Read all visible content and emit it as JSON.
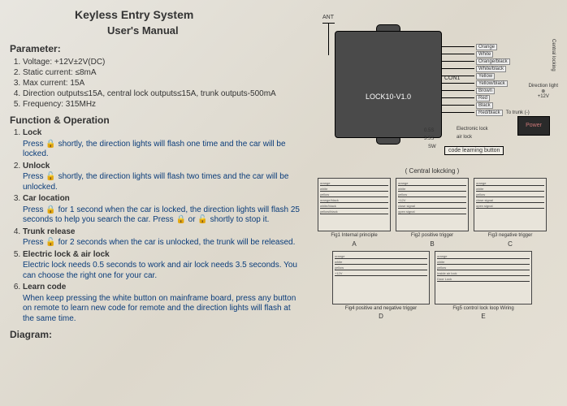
{
  "header": {
    "title": "Keyless Entry System",
    "subtitle": "User's Manual"
  },
  "parameter": {
    "heading": "Parameter:",
    "items": [
      "Voltage: +12V±2V(DC)",
      "Static current: ≤8mA",
      "Max current: 15A",
      "Direction outputs≤15A, central lock outputs≤15A, trunk outputs-500mA",
      "Frequency: 315MHz"
    ]
  },
  "function": {
    "heading": "Function & Operation",
    "items": [
      {
        "title": "Lock",
        "body": "Press 🔒 shortly, the direction lights will flash one time and the car will be locked."
      },
      {
        "title": "Unlock",
        "body": "Press 🔓 shortly, the direction lights will flash two times and the car will be unlocked."
      },
      {
        "title": "Car location",
        "body": "Press 🔒 for 1 second when the car is locked, the direction lights will flash 25 seconds to help you search the car. Press 🔒 or 🔓 shortly to stop it."
      },
      {
        "title": "Trunk release",
        "body": "Press 🔓 for 2 seconds when the car is unlocked, the trunk will be released."
      },
      {
        "title": "Electric lock & air lock",
        "body": "Electric lock needs 0.5 seconds to work and air lock needs 3.5 seconds. You can choose the right one for your car."
      },
      {
        "title": "Learn code",
        "body": "When keep pressing the white button on mainframe board, press any button on remote to learn new code for remote and the direction lights will flash at the same time."
      }
    ]
  },
  "diagram_heading": "Diagram:",
  "main_diagram": {
    "ant": "ANT",
    "chip": "LOCK10-V1.0",
    "con": "CON1",
    "wires": [
      "Orange",
      "White",
      "Orange/black",
      "White/black",
      "Yellow",
      "Yellow/black",
      "Brown",
      "Red",
      "Black",
      "Red/black"
    ],
    "central_locking": "Central locking",
    "direction_light": "Direction light",
    "to_trunk": "To trunk (-)",
    "plus12v": "+12V",
    "power": "Power",
    "elock_time": "0.5S",
    "airlock_time": "3.5S",
    "sw": "SW",
    "elock": "Electronic lock",
    "airlock": "air lock",
    "learn": "code learning button"
  },
  "sub": {
    "group_title": "( Central lokcking )",
    "boxes": [
      {
        "cap": "Fig1 Internal principle",
        "letter": "A",
        "labels": [
          "orange",
          "white",
          "yellow",
          "orange/black",
          "white/black",
          "yellow/black"
        ]
      },
      {
        "cap": "Fig2 positive trigger",
        "letter": "B",
        "labels": [
          "orange",
          "white",
          "yellow",
          "+12V",
          "close signal",
          "open signal"
        ]
      },
      {
        "cap": "Fig3 negative trigger",
        "letter": "C",
        "labels": [
          "orange",
          "white",
          "yellow",
          "close signal",
          "open signal"
        ]
      },
      {
        "cap": "Fig4 positive and negative trigger",
        "letter": "D",
        "labels": [
          "orange",
          "white",
          "yellow",
          "+12V"
        ]
      },
      {
        "cap": "Fig5 control lock loop Wiring",
        "letter": "E",
        "labels": [
          "orange",
          "white",
          "yellow",
          "Inside air lock",
          "Door Lock"
        ]
      }
    ]
  }
}
